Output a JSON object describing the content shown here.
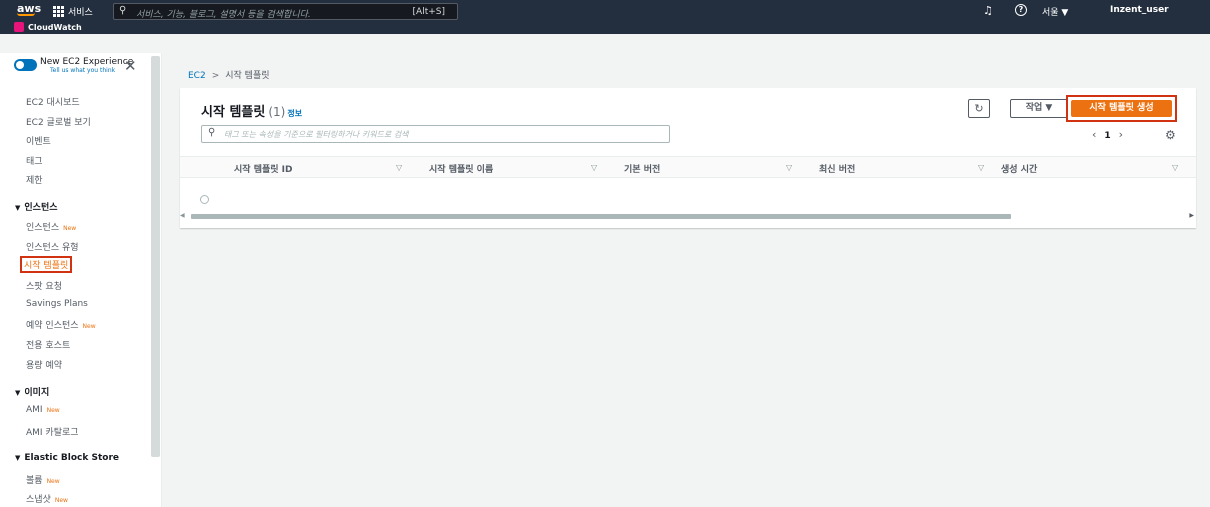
{
  "topnav": {
    "logo": "aws",
    "services_label": "서비스",
    "search_placeholder": "서비스, 기능, 블로그, 설명서 등을 검색합니다.",
    "search_shortcut": "[Alt+S]",
    "region": "서울 ▼",
    "user": "Inzent_user",
    "favorite": "CloudWatch"
  },
  "sidebar": {
    "toggle_title": "New EC2 Experience",
    "toggle_sub": "Tell us what you think",
    "items_top": [
      "EC2 대시보드",
      "EC2 글로벌 보기",
      "이벤트",
      "태그",
      "제한"
    ],
    "section_instances": "인스턴스",
    "instances": [
      {
        "label": "인스턴스",
        "badge": "New"
      },
      {
        "label": "인스턴스 유형",
        "badge": ""
      },
      {
        "label": "시작 템플릿",
        "badge": ""
      },
      {
        "label": "스팟 요청",
        "badge": ""
      },
      {
        "label": "Savings Plans",
        "badge": ""
      },
      {
        "label": "예약 인스턴스",
        "badge": "New"
      },
      {
        "label": "전용 호스트",
        "badge": ""
      },
      {
        "label": "용량 예약",
        "badge": ""
      }
    ],
    "section_images": "이미지",
    "images": [
      {
        "label": "AMI",
        "badge": "New"
      },
      {
        "label": "AMI 카탈로그",
        "badge": ""
      }
    ],
    "section_ebs": "Elastic Block Store",
    "ebs": [
      {
        "label": "볼륨",
        "badge": "New"
      },
      {
        "label": "스냅샷",
        "badge": "New"
      }
    ]
  },
  "breadcrumb": {
    "root": "EC2",
    "current": "시작 템플릿"
  },
  "panel": {
    "title": "시작 템플릿",
    "count": "(1)",
    "info": "정보",
    "action_label": "작업 ▼",
    "create_label": "시작 템플릿 생성",
    "filter_placeholder": "태그 또는 속성을 기준으로 필터링하거나 키워드로 검색",
    "page": "1",
    "columns": [
      "시작 템플릿 ID",
      "시작 템플릿 이름",
      "기본 버전",
      "최신 버전",
      "생성 시간"
    ]
  }
}
